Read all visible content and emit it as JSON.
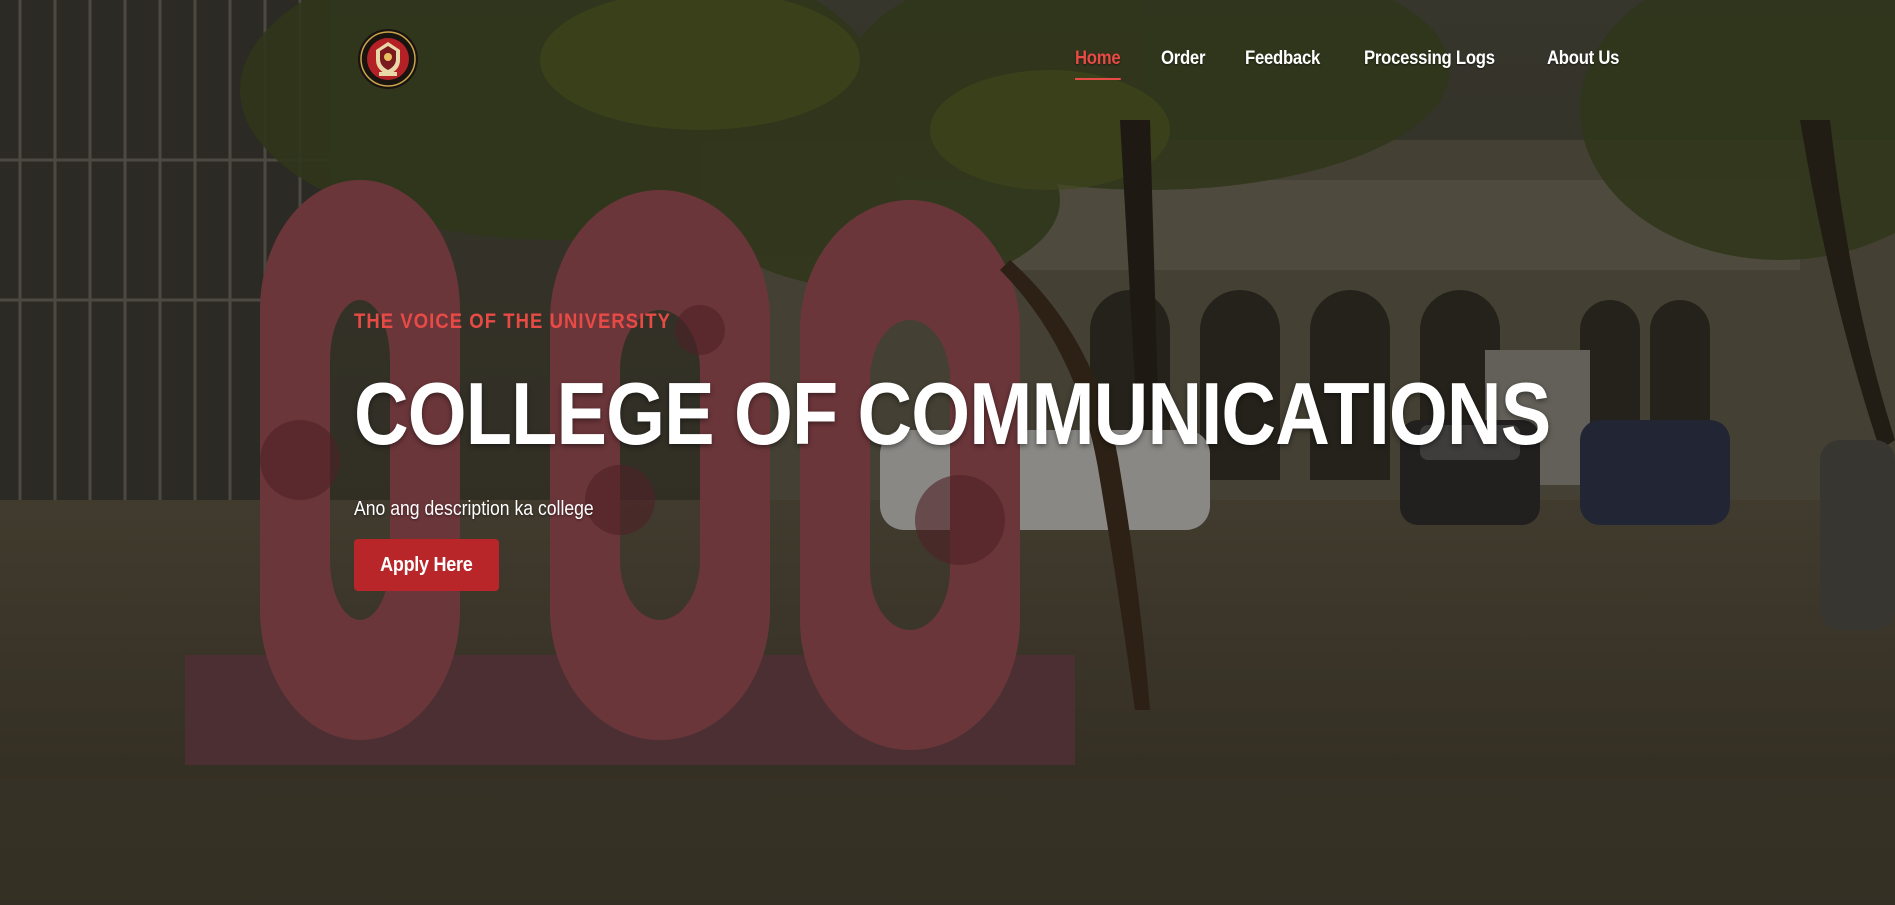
{
  "header": {
    "logo_icon": "university-seal-icon",
    "nav": [
      {
        "label": "Home",
        "active": true
      },
      {
        "label": "Order",
        "active": false
      },
      {
        "label": "Feedback",
        "active": false
      },
      {
        "label": "Processing Logs",
        "active": false
      },
      {
        "label": "About Us",
        "active": false
      }
    ]
  },
  "hero": {
    "eyebrow": "THE VOICE OF THE UNIVERSITY",
    "title": "COLLEGE OF COMMUNICATIONS",
    "description": "Ano ang description ka college",
    "cta_label": "Apply Here"
  },
  "colors": {
    "accent": "#e84a45",
    "button": "#b9262a",
    "text": "#ffffff"
  }
}
